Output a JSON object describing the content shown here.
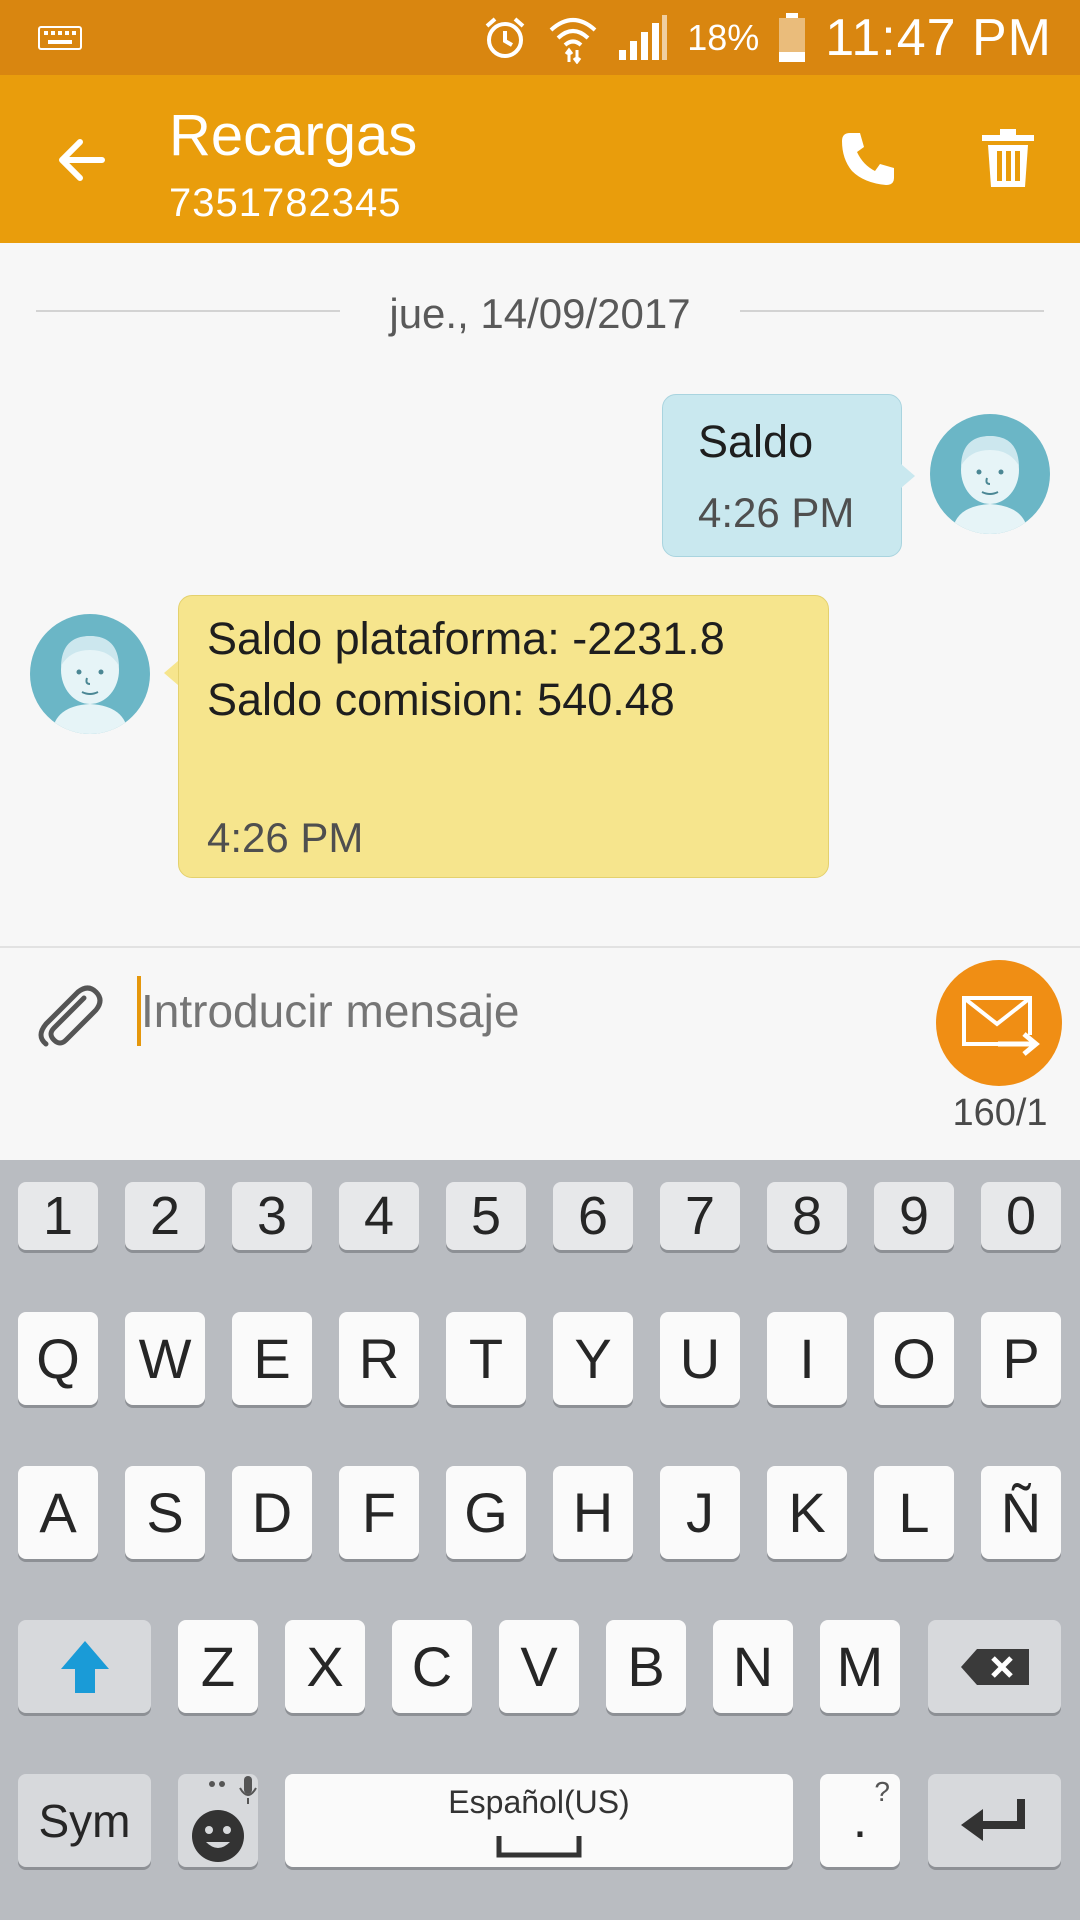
{
  "status_bar": {
    "battery_percent": "18%",
    "time": "11:47 PM",
    "icons": [
      "keyboard-icon",
      "alarm-icon",
      "wifi-icon",
      "signal-icon",
      "battery-icon"
    ]
  },
  "app_bar": {
    "title": "Recargas",
    "subtitle": "7351782345",
    "accent_color": "#e99d0c"
  },
  "conversation": {
    "date_divider": "jue., 14/09/2017",
    "messages": [
      {
        "direction": "sent",
        "text": "Saldo",
        "time": "4:26 PM",
        "color": "#c9e8ef"
      },
      {
        "direction": "received",
        "text": "Saldo plataforma: -2231.8\nSaldo comision: 540.48",
        "time": "4:26 PM",
        "color": "#f6e58d"
      }
    ]
  },
  "composer": {
    "placeholder": "Introducir mensaje",
    "char_count": "160/1",
    "send_color": "#f08e14"
  },
  "keyboard": {
    "rows": [
      [
        "1",
        "2",
        "3",
        "4",
        "5",
        "6",
        "7",
        "8",
        "9",
        "0"
      ],
      [
        "Q",
        "W",
        "E",
        "R",
        "T",
        "Y",
        "U",
        "I",
        "O",
        "P"
      ],
      [
        "A",
        "S",
        "D",
        "F",
        "G",
        "H",
        "J",
        "K",
        "L",
        "Ñ"
      ],
      [
        "Z",
        "X",
        "C",
        "V",
        "B",
        "N",
        "M"
      ]
    ],
    "sym_label": "Sym",
    "space_label": "Español(US)",
    "period_label": ".",
    "period_hint": "?"
  }
}
